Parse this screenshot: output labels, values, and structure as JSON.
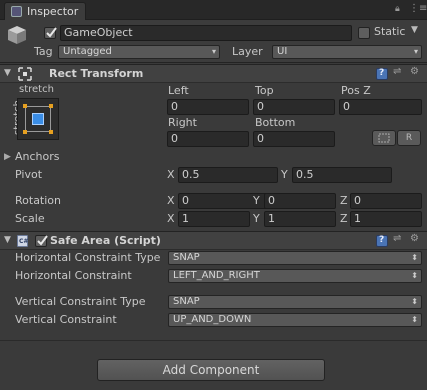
{
  "window": {
    "tab_label": "Inspector"
  },
  "gameobject": {
    "name": "GameObject",
    "active": true,
    "static_label": "Static",
    "tag_label": "Tag",
    "tag_value": "Untagged",
    "layer_label": "Layer",
    "layer_value": "UI"
  },
  "rect_transform": {
    "title": "Rect Transform",
    "anchor_preset_top": "stretch",
    "anchor_preset_side": "stretch",
    "left_label": "Left",
    "left_value": "0",
    "top_label": "Top",
    "top_value": "0",
    "posz_label": "Pos Z",
    "posz_value": "0",
    "right_label": "Right",
    "right_value": "0",
    "bottom_label": "Bottom",
    "bottom_value": "0",
    "raw_edit_button": "R",
    "anchors_label": "Anchors",
    "pivot_label": "Pivot",
    "pivot_x": "0.5",
    "pivot_y": "0.5",
    "rotation_label": "Rotation",
    "rotation_x": "0",
    "rotation_y": "0",
    "rotation_z": "0",
    "scale_label": "Scale",
    "scale_x": "1",
    "scale_y": "1",
    "scale_z": "1",
    "axis_x": "X",
    "axis_y": "Y",
    "axis_z": "Z"
  },
  "safe_area": {
    "title": "Safe Area (Script)",
    "enabled": true,
    "h_type_label": "Horizontal Constraint Type",
    "h_type_value": "SNAP",
    "h_constraint_label": "Horizontal Constraint",
    "h_constraint_value": "LEFT_AND_RIGHT",
    "v_type_label": "Vertical Constraint Type",
    "v_type_value": "SNAP",
    "v_constraint_label": "Vertical Constraint",
    "v_constraint_value": "UP_AND_DOWN"
  },
  "add_component_label": "Add Component",
  "colors": {
    "background": "#3a3a3a",
    "field": "#2a2a2a",
    "accent_blue": "#3a8de6",
    "anchor_orange": "#e6a020"
  }
}
